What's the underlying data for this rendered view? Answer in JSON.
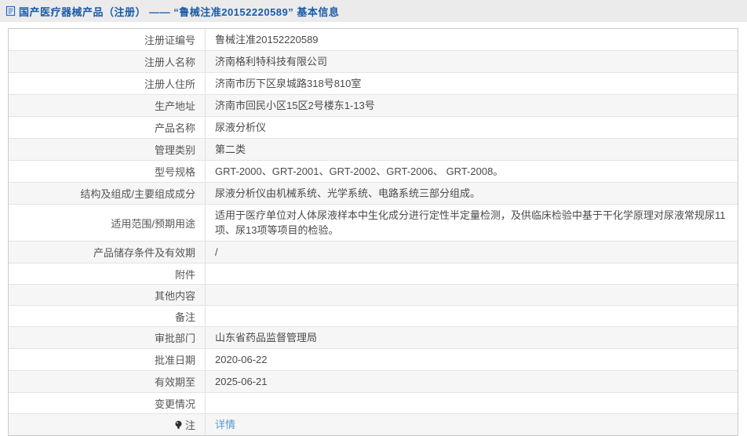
{
  "colors": {
    "header_title": "#1a5aa8",
    "link": "#5b97d5",
    "row_alt_background": "#f6f6f6"
  },
  "header": {
    "icon": "document-icon",
    "title": "国产医疗器械产品（注册） —— “鲁械注准20152220589” 基本信息"
  },
  "table": {
    "rows": [
      {
        "label": "注册证编号",
        "value": "鲁械注准20152220589"
      },
      {
        "label": "注册人名称",
        "value": "济南格利特科技有限公司"
      },
      {
        "label": "注册人住所",
        "value": "济南市历下区泉城路318号810室"
      },
      {
        "label": "生产地址",
        "value": "济南市回民小区15区2号楼东1-13号"
      },
      {
        "label": "产品名称",
        "value": "尿液分析仪"
      },
      {
        "label": "管理类别",
        "value": "第二类"
      },
      {
        "label": "型号规格",
        "value": "GRT-2000、GRT-2001、GRT-2002、GRT-2006、 GRT-2008。"
      },
      {
        "label": "结构及组成/主要组成成分",
        "value": "尿液分析仪由机械系统、光学系统、电路系统三部分组成。"
      },
      {
        "label": "适用范围/预期用途",
        "value": "适用于医疗单位对人体尿液样本中生化成分进行定性半定量检测，及供临床检验中基于干化学原理对尿液常规尿11项、尿13项等项目的检验。"
      },
      {
        "label": "产品储存条件及有效期",
        "value": "/"
      },
      {
        "label": "附件",
        "value": ""
      },
      {
        "label": "其他内容",
        "value": ""
      },
      {
        "label": "备注",
        "value": ""
      },
      {
        "label": "审批部门",
        "value": "山东省药品监督管理局"
      },
      {
        "label": "批准日期",
        "value": "2020-06-22"
      },
      {
        "label": "有效期至",
        "value": "2025-06-21"
      },
      {
        "label": "变更情况",
        "value": ""
      },
      {
        "label": "注",
        "value": "详情",
        "icon": "note-bulb-icon"
      }
    ]
  }
}
